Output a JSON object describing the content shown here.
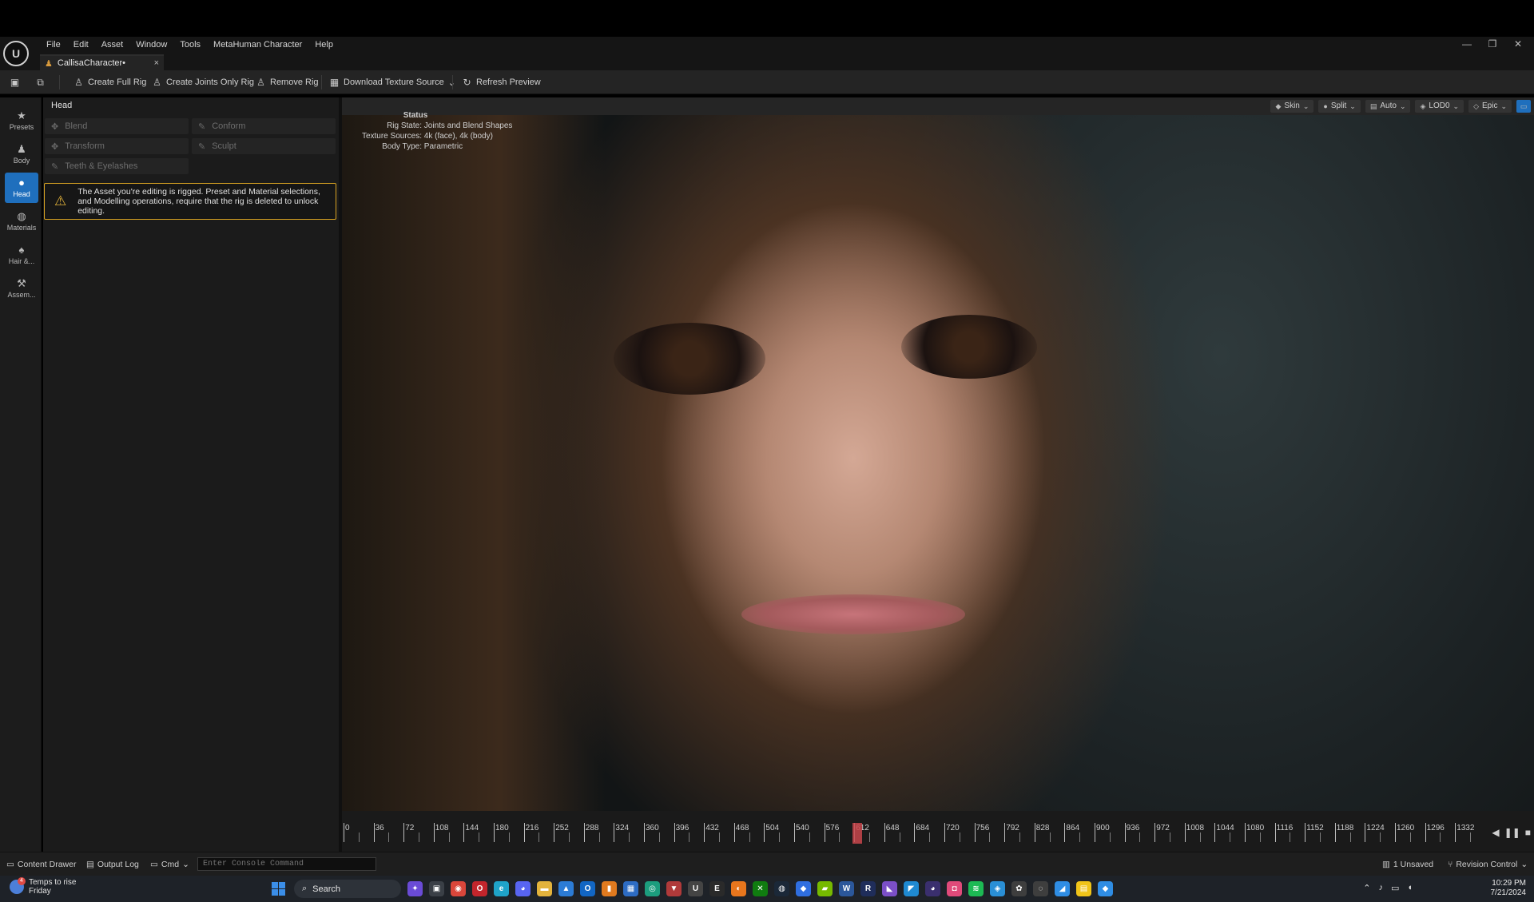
{
  "menu": [
    "File",
    "Edit",
    "Asset",
    "Window",
    "Tools",
    "MetaHuman Character",
    "Help"
  ],
  "window_controls": [
    "—",
    "❐",
    "✕"
  ],
  "document_tab": {
    "label": "CallisaCharacter•",
    "close": "×"
  },
  "toolbar": {
    "create_full_rig": "Create Full Rig",
    "create_joints_only_rig": "Create Joints Only Rig",
    "remove_rig": "Remove Rig",
    "download_texture_source": "Download Texture Source",
    "refresh_preview": "Refresh Preview"
  },
  "rail": [
    {
      "label": "Presets",
      "icon": "star-icon",
      "glyph": "★"
    },
    {
      "label": "Body",
      "icon": "body-icon",
      "glyph": "♟"
    },
    {
      "label": "Head",
      "icon": "head-icon",
      "glyph": "●"
    },
    {
      "label": "Materials",
      "icon": "materials-icon",
      "glyph": "◍"
    },
    {
      "label": "Hair &...",
      "icon": "hair-icon",
      "glyph": "♠"
    },
    {
      "label": "Assem...",
      "icon": "assembly-icon",
      "glyph": "⚒"
    }
  ],
  "panel": {
    "title": "Head",
    "tools": [
      "Blend",
      "Conform",
      "Transform",
      "Sculpt",
      "Teeth & Eyelashes"
    ],
    "warning_line1": "The Asset you're editing is rigged. Preset and Material selections,",
    "warning_line2": "and Modelling operations, require that the rig is deleted to unlock editing."
  },
  "viewport": {
    "options": [
      "Skin",
      "Split",
      "Auto",
      "LOD0",
      "Epic"
    ],
    "status_title": "Status",
    "status": [
      {
        "key": "Rig State:",
        "value": "Joints and Blend Shapes"
      },
      {
        "key": "Texture Sources:",
        "value": "4k (face), 4k (body)"
      },
      {
        "key": "Body Type:",
        "value": "Parametric"
      }
    ]
  },
  "timeline": {
    "labels": [
      "0",
      "36",
      "72",
      "108",
      "144",
      "180",
      "216",
      "252",
      "288",
      "324",
      "360",
      "396",
      "432",
      "468",
      "504",
      "540",
      "576",
      "612",
      "648",
      "684",
      "720",
      "756",
      "792",
      "828",
      "864",
      "900",
      "936",
      "972",
      "1008",
      "1044",
      "1080",
      "1116",
      "1152",
      "1188",
      "1224",
      "1260",
      "1296",
      "1332"
    ],
    "current_frame": 612
  },
  "statusbar": {
    "content_drawer": "Content Drawer",
    "output_log": "Output Log",
    "cmd": "Cmd",
    "console_placeholder": "Enter Console Command",
    "unsaved": "1 Unsaved",
    "revision_control": "Revision Control"
  },
  "taskbar": {
    "weather_badge": "4",
    "weather_line1": "Temps to rise",
    "weather_line2": "Friday",
    "search": "Search",
    "time": "10:29 PM",
    "date": "7/21/2024"
  },
  "colors": {
    "accent": "#1f6fbd",
    "warning": "#d9a322",
    "timeline_cursor": "#c9474c"
  }
}
